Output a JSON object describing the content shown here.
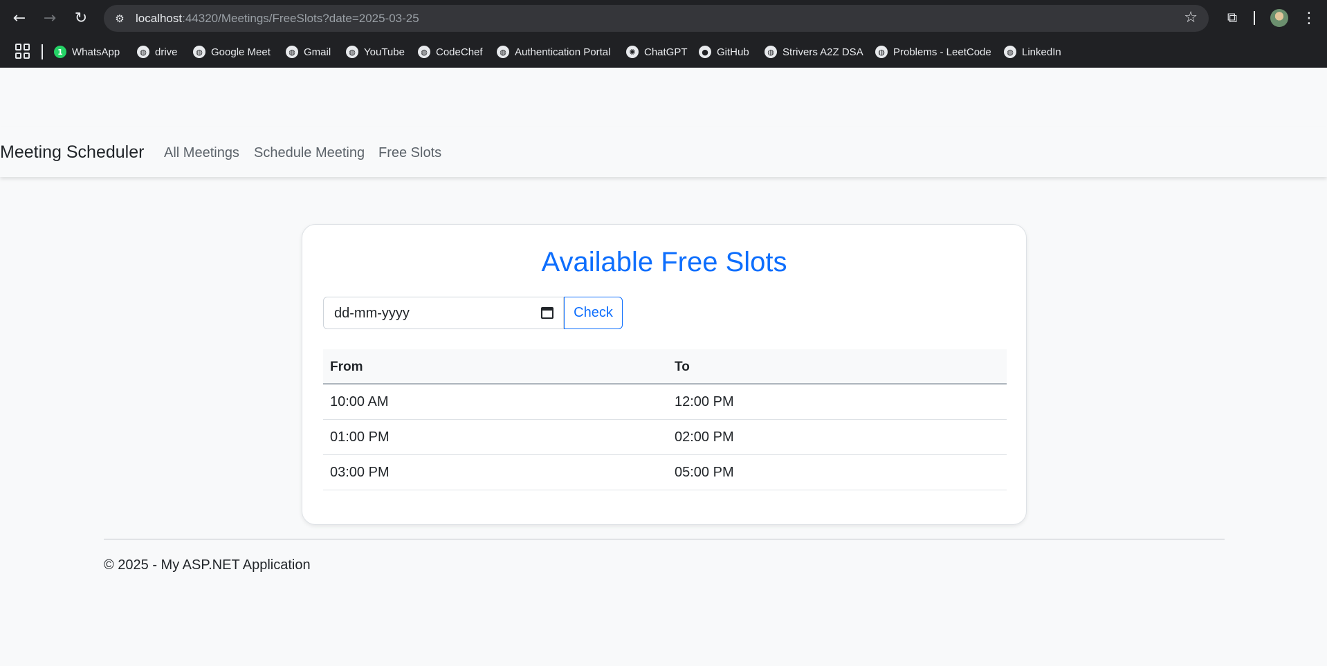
{
  "browser": {
    "url_host": "localhost",
    "url_rest": ":44320/Meetings/FreeSlots?date=2025-03-25",
    "bookmarks": [
      {
        "label": "WhatsApp",
        "icon": "whatsapp-icon"
      },
      {
        "label": "drive",
        "icon": "globe-icon"
      },
      {
        "label": "Google Meet",
        "icon": "globe-icon"
      },
      {
        "label": "Gmail",
        "icon": "globe-icon"
      },
      {
        "label": "YouTube",
        "icon": "globe-icon"
      },
      {
        "label": "CodeChef",
        "icon": "globe-icon"
      },
      {
        "label": "Authentication Portal",
        "icon": "globe-icon"
      },
      {
        "label": "ChatGPT",
        "icon": "chatgpt-icon"
      },
      {
        "label": "GitHub",
        "icon": "github-icon"
      },
      {
        "label": "Strivers A2Z DSA",
        "icon": "globe-icon"
      },
      {
        "label": "Problems - LeetCode",
        "icon": "globe-icon"
      },
      {
        "label": "LinkedIn",
        "icon": "globe-icon"
      }
    ],
    "whatsapp_badge": "1"
  },
  "navbar": {
    "brand": "Meeting Scheduler",
    "links": [
      "All Meetings",
      "Schedule Meeting",
      "Free Slots"
    ]
  },
  "card": {
    "title": "Available Free Slots",
    "date_placeholder": "dd-mm-yyyy",
    "check_label": "Check",
    "columns": [
      "From",
      "To"
    ],
    "rows": [
      [
        "10:00 AM",
        "12:00 PM"
      ],
      [
        "01:00 PM",
        "02:00 PM"
      ],
      [
        "03:00 PM",
        "05:00 PM"
      ]
    ]
  },
  "footer": {
    "text": "© 2025 - My ASP.NET Application"
  },
  "colors": {
    "accent": "#0d6efd",
    "chrome_bg": "#202124"
  }
}
